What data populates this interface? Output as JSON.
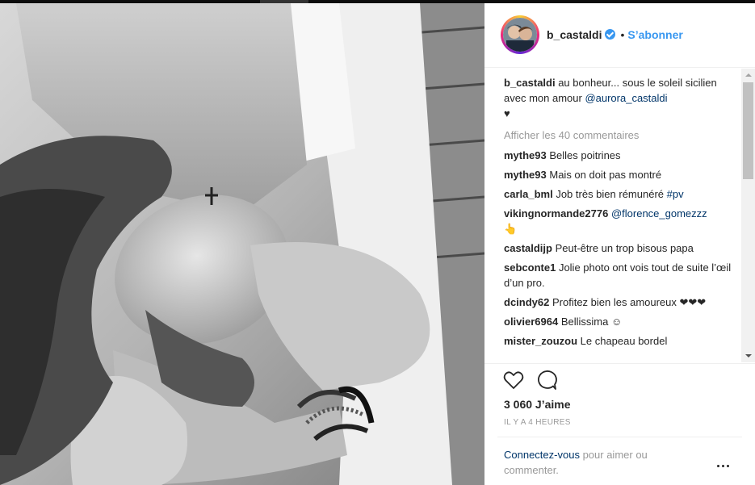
{
  "post": {
    "username": "b_castaldi",
    "separator": "•",
    "follow_label": "S’abonner",
    "caption": {
      "username": "b_castaldi",
      "text": " au bonheur... sous le soleil sicilien avec mon amour ",
      "mention": "@aurora_castaldi",
      "emoji": "♥"
    },
    "view_all_comments": "Afficher les 40 commentaires",
    "comments": [
      {
        "user": "mythe93",
        "text": "Belles poitrines"
      },
      {
        "user": "mythe93",
        "text": "Mais on doit pas montré"
      },
      {
        "user": "carla_bml",
        "text": "Job très bien rémunéré ",
        "tag": "#pv"
      },
      {
        "user": "vikingnormande2776",
        "text": " ",
        "tag": "@florence_gomezzz",
        "emoji": "👆"
      },
      {
        "user": "castaldijp",
        "text": "Peut-être un trop bisous papa"
      },
      {
        "user": "sebconte1",
        "text": "Jolie photo ont vois tout de suite l’œil d’un pro."
      },
      {
        "user": "dcindy62",
        "text": "Profitez bien les amoureux ❤❤❤"
      },
      {
        "user": "olivier6964",
        "text": "Bellissima ☺"
      },
      {
        "user": "mister_zouzou",
        "text": "Le chapeau bordel"
      }
    ],
    "likes": "3 060 J’aime",
    "time_ago": "IL Y A 4 HEURES",
    "login_prompt": {
      "link": "Connectez-vous",
      "text": " pour aimer ou commenter."
    }
  },
  "icons": {
    "like": "heart-outline-icon",
    "comment": "speech-bubble-icon",
    "options": "more-options-icon",
    "verified": "verified-badge-icon"
  },
  "colors": {
    "accent": "#3897f0",
    "link": "#003569",
    "muted": "#999999",
    "text": "#262626"
  }
}
